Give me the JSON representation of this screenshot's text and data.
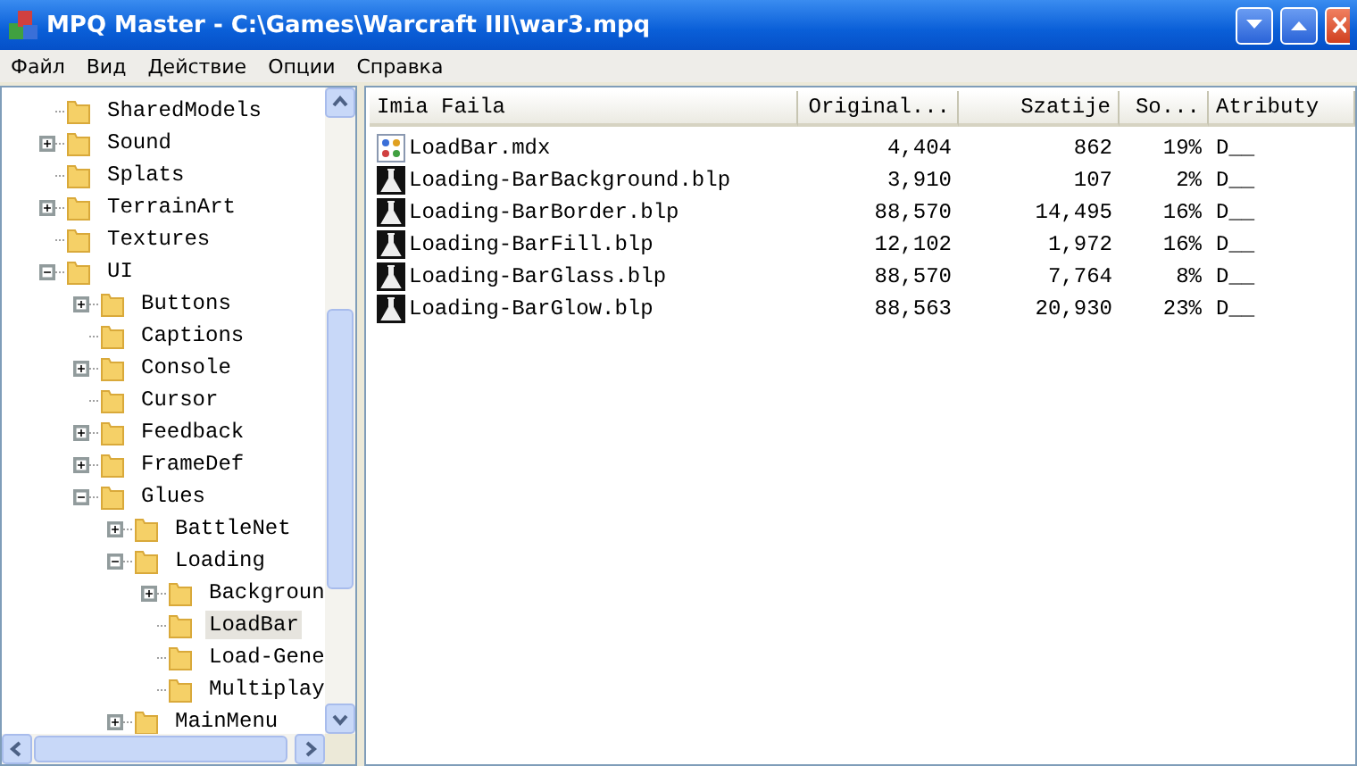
{
  "window": {
    "title": "MPQ Master - C:\\Games\\Warcraft III\\war3.mpq"
  },
  "menu": [
    "Файл",
    "Вид",
    "Действие",
    "Опции",
    "Справка"
  ],
  "tree": [
    {
      "label": "SharedModels",
      "selected": false
    },
    {
      "label": "Sound",
      "selected": false,
      "expanded": false
    },
    {
      "label": "Splats",
      "selected": false
    },
    {
      "label": "TerrainArt",
      "selected": false,
      "expanded": false
    },
    {
      "label": "Textures",
      "selected": false
    },
    {
      "label": "UI",
      "selected": false,
      "expanded": true,
      "children": [
        {
          "label": "Buttons",
          "selected": false,
          "expanded": false
        },
        {
          "label": "Captions",
          "selected": false
        },
        {
          "label": "Console",
          "selected": false,
          "expanded": false
        },
        {
          "label": "Cursor",
          "selected": false
        },
        {
          "label": "Feedback",
          "selected": false,
          "expanded": false
        },
        {
          "label": "FrameDef",
          "selected": false,
          "expanded": false
        },
        {
          "label": "Glues",
          "selected": false,
          "expanded": true,
          "children": [
            {
              "label": "BattleNet",
              "selected": false,
              "expanded": false
            },
            {
              "label": "Loading",
              "selected": false,
              "expanded": true,
              "children": [
                {
                  "label": "Backgroun",
                  "selected": false,
                  "expanded": false
                },
                {
                  "label": "LoadBar",
                  "selected": true
                },
                {
                  "label": "Load-Gene",
                  "selected": false
                },
                {
                  "label": "Multiplay",
                  "selected": false
                }
              ]
            },
            {
              "label": "MainMenu",
              "selected": false,
              "expanded": false
            }
          ]
        }
      ]
    }
  ],
  "table": {
    "columns": [
      "Imia Faila",
      "Original...",
      "Szatije",
      "So...",
      "Atributy"
    ],
    "rows": [
      {
        "kind": "model",
        "cells": [
          "LoadBar.mdx",
          "4,404",
          "862",
          "19%",
          "D__"
        ]
      },
      {
        "kind": "image",
        "cells": [
          "Loading-BarBackground.blp",
          "3,910",
          "107",
          "2%",
          "D__"
        ]
      },
      {
        "kind": "image",
        "cells": [
          "Loading-BarBorder.blp",
          "88,570",
          "14,495",
          "16%",
          "D__"
        ]
      },
      {
        "kind": "image",
        "cells": [
          "Loading-BarFill.blp",
          "12,102",
          "1,972",
          "16%",
          "D__"
        ]
      },
      {
        "kind": "image",
        "cells": [
          "Loading-BarGlass.blp",
          "88,570",
          "7,764",
          "8%",
          "D__"
        ]
      },
      {
        "kind": "image",
        "cells": [
          "Loading-BarGlow.blp",
          "88,563",
          "20,930",
          "23%",
          "D__"
        ]
      }
    ]
  }
}
